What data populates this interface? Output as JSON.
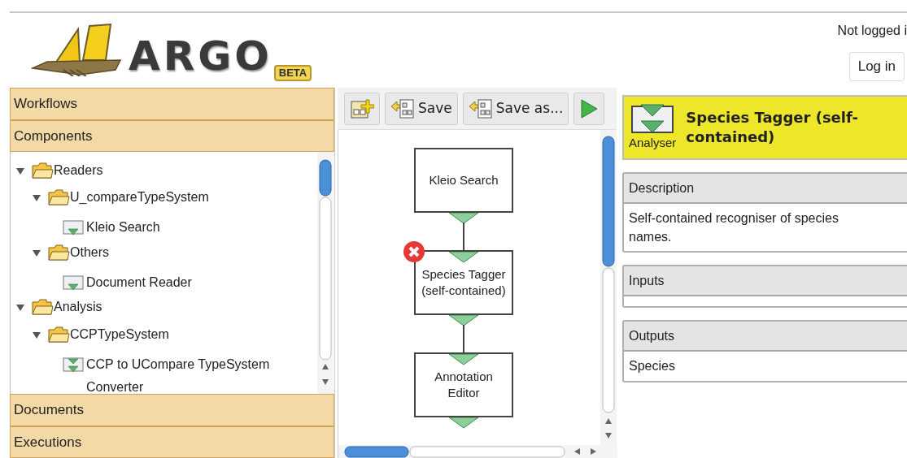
{
  "header": {
    "logo_text": "ARGO",
    "logo_badge": "BETA",
    "login_status": "Not logged i",
    "login_button": "Log in"
  },
  "sidebar": {
    "sections": [
      {
        "label": "Workflows",
        "expanded": false
      },
      {
        "label": "Components",
        "expanded": true,
        "tree": [
          {
            "label": "Readers",
            "kind": "folder",
            "expanded": true,
            "children": [
              {
                "label": "U_compareTypeSystem",
                "kind": "folder",
                "expanded": true,
                "children": [
                  {
                    "label": "Kleio Search",
                    "kind": "reader"
                  }
                ]
              },
              {
                "label": "Others",
                "kind": "folder",
                "expanded": true,
                "children": [
                  {
                    "label": "Document Reader",
                    "kind": "reader"
                  }
                ]
              }
            ]
          },
          {
            "label": "Analysis",
            "kind": "folder",
            "expanded": true,
            "children": [
              {
                "label": "CCPTypeSystem",
                "kind": "folder",
                "expanded": true,
                "children": [
                  {
                    "label": "CCP to UCompare TypeSystem Converter",
                    "kind": "analyser"
                  }
                ]
              }
            ]
          }
        ]
      },
      {
        "label": "Documents",
        "expanded": false
      },
      {
        "label": "Executions",
        "expanded": false
      }
    ]
  },
  "toolbar": [
    {
      "kind": "add"
    },
    {
      "kind": "save",
      "label": "Save"
    },
    {
      "kind": "save",
      "label": "Save as..."
    },
    {
      "kind": "run"
    }
  ],
  "canvas": {
    "nodes": [
      {
        "label": "Kleio Search",
        "kind": "reader",
        "error": false
      },
      {
        "label": "Species Tagger (self-contained)",
        "kind": "analyser",
        "error": true
      },
      {
        "label": "Annotation Editor",
        "kind": "analyser",
        "error": false
      }
    ]
  },
  "details": {
    "type_label": "Analyser",
    "title": "Species Tagger (self-contained)",
    "sections": [
      {
        "heading": "Description",
        "body": "Self-contained recogniser of species names."
      },
      {
        "heading": "Inputs"
      },
      {
        "heading": "Outputs",
        "body": "Species"
      }
    ]
  }
}
